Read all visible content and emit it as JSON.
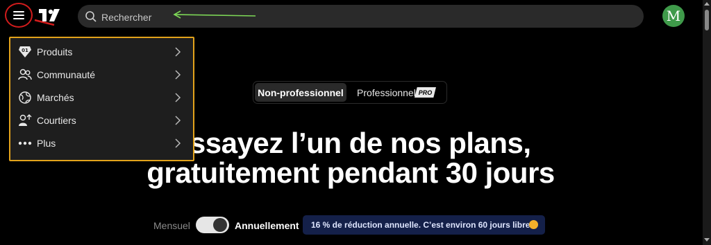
{
  "header": {
    "search_placeholder": "Rechercher",
    "avatar_letter": "M"
  },
  "menu": {
    "items": [
      {
        "label": "Produits",
        "icon": "diamond-icon"
      },
      {
        "label": "Communauté",
        "icon": "people-icon"
      },
      {
        "label": "Marchés",
        "icon": "globe-icon"
      },
      {
        "label": "Courtiers",
        "icon": "broker-icon"
      },
      {
        "label": "Plus",
        "icon": "more-dots-icon"
      }
    ]
  },
  "plans": {
    "tab_nonpro": "Non-professionnel",
    "tab_pro": "Professionnel",
    "pro_badge": "PRO"
  },
  "hero": {
    "line1": "Essayez l’un de nos plans,",
    "line2": "gratuitement pendant 30 jours"
  },
  "billing": {
    "monthly_label": "Mensuel",
    "yearly_label": "Annuellement",
    "promo_text": "16 % de réduction annuelle. C’est environ 60 jours libre"
  },
  "colors": {
    "background": "#000000",
    "dropdown_border": "#e3a31b",
    "menu_circle": "#d21c1c",
    "annotation_arrow": "#7ed957",
    "avatar": "#3f9a4a",
    "promo_bg": "#142049"
  }
}
